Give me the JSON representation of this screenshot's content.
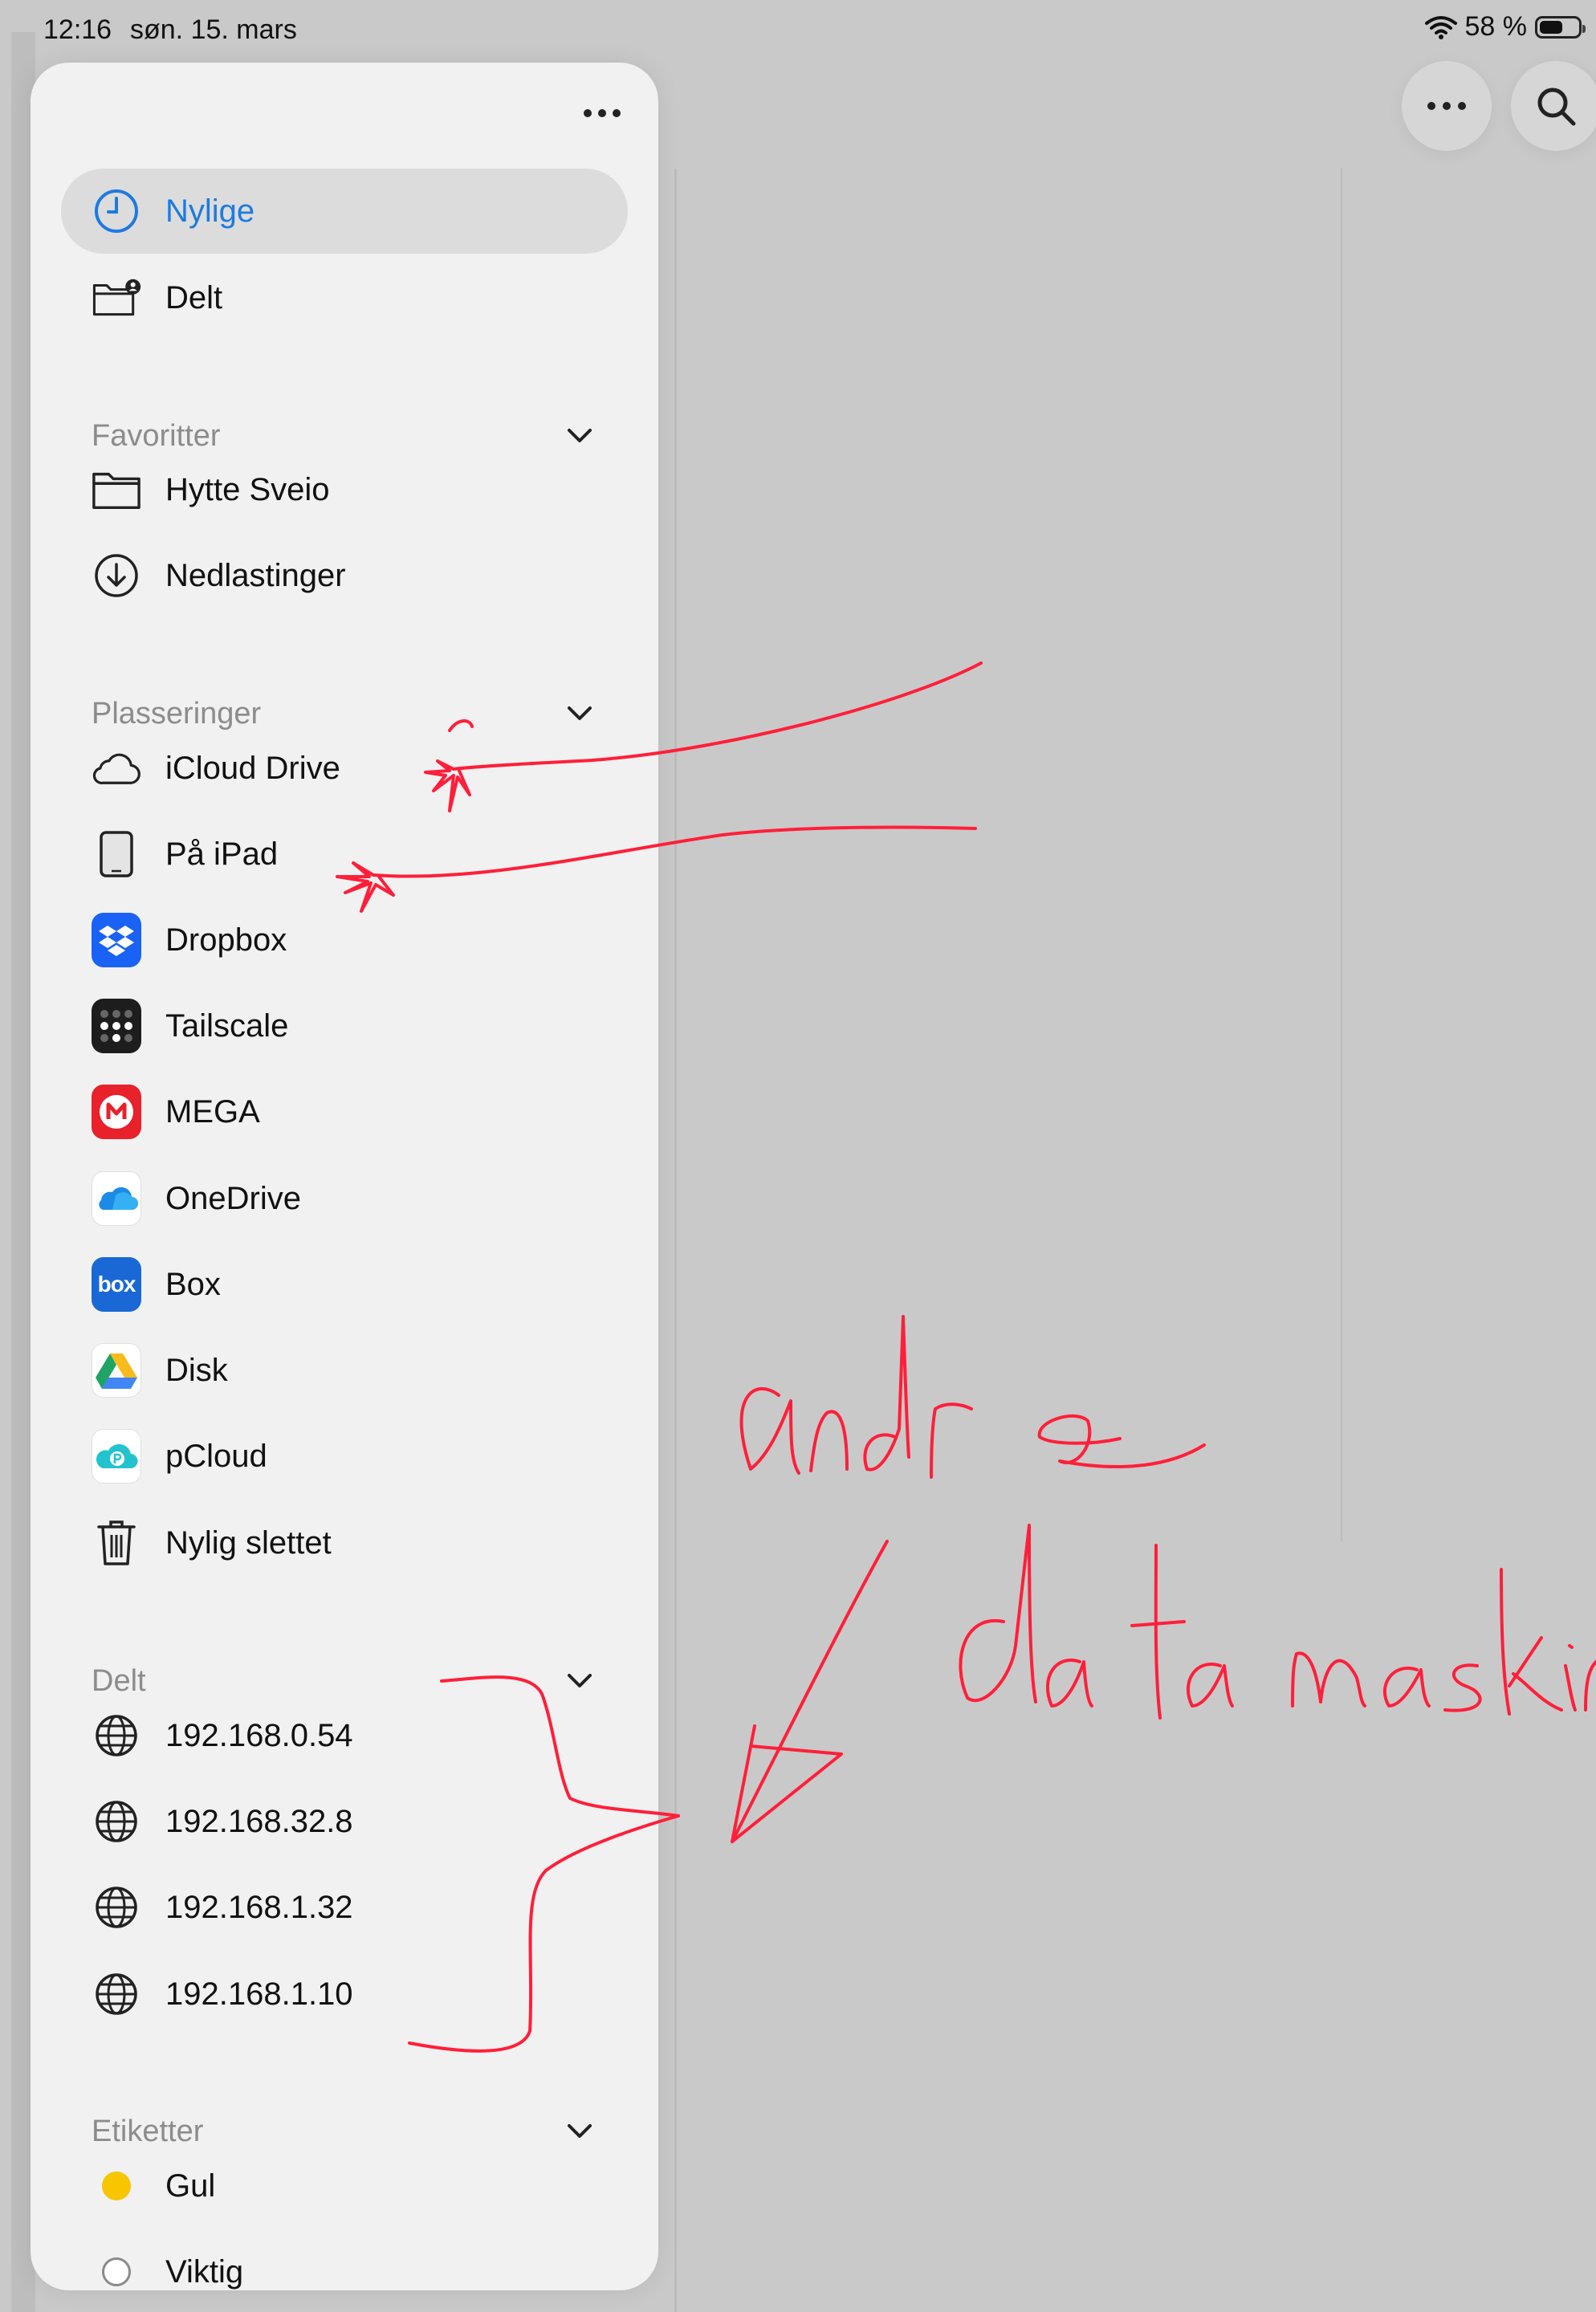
{
  "status_bar": {
    "time": "12:16",
    "date": "søn. 15. mars",
    "battery": "58 %"
  },
  "sidebar": {
    "top_items": [
      {
        "label": "Nylige",
        "icon": "clock-icon",
        "active": true
      },
      {
        "label": "Delt",
        "icon": "shared-folder-icon",
        "active": false
      }
    ],
    "favorites": {
      "title": "Favoritter",
      "items": [
        {
          "label": "Hytte Sveio",
          "icon": "folder-icon"
        },
        {
          "label": "Nedlastinger",
          "icon": "download-icon"
        }
      ]
    },
    "locations": {
      "title": "Plasseringer",
      "items": [
        {
          "label": "iCloud Drive",
          "icon": "cloud-icon"
        },
        {
          "label": "På iPad",
          "icon": "ipad-icon"
        },
        {
          "label": "Dropbox",
          "icon": "dropbox-icon"
        },
        {
          "label": "Tailscale",
          "icon": "tailscale-icon"
        },
        {
          "label": "MEGA",
          "icon": "mega-icon"
        },
        {
          "label": "OneDrive",
          "icon": "onedrive-icon"
        },
        {
          "label": "Box",
          "icon": "box-icon"
        },
        {
          "label": "Disk",
          "icon": "google-drive-icon"
        },
        {
          "label": "pCloud",
          "icon": "pcloud-icon"
        },
        {
          "label": "Nylig slettet",
          "icon": "trash-icon"
        }
      ]
    },
    "shared": {
      "title": "Delt",
      "items": [
        {
          "label": "192.168.0.54",
          "icon": "globe-icon"
        },
        {
          "label": "192.168.32.8",
          "icon": "globe-icon"
        },
        {
          "label": "192.168.1.32",
          "icon": "globe-icon"
        },
        {
          "label": "192.168.1.10",
          "icon": "globe-icon"
        }
      ]
    },
    "tags": {
      "title": "Etiketter",
      "items": [
        {
          "label": "Gul",
          "color": "#f7c600"
        },
        {
          "label": "Viktig",
          "color": "#ffffff"
        }
      ]
    }
  },
  "annotation_text": {
    "line1": "andre",
    "line2": "datamaskin"
  },
  "colors": {
    "accent": "#1f7ae0",
    "annotation": "#ff1f3a"
  }
}
